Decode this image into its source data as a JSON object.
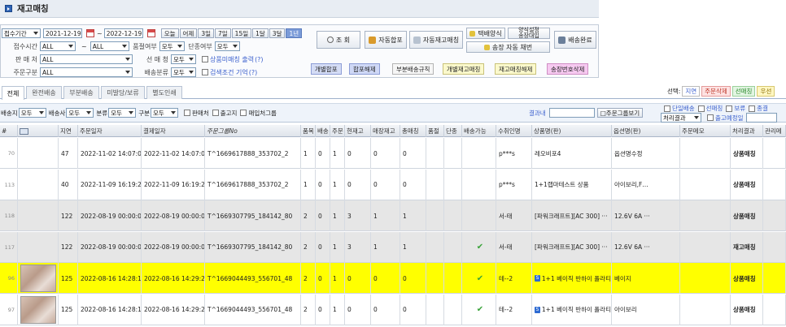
{
  "title": "재고매칭",
  "filters": {
    "date_type": "접수기간",
    "date_from": "2021-12-19",
    "tilde": "~",
    "date_to": "2022-12-19",
    "quick_ranges": [
      "오늘",
      "어제",
      "3일",
      "7일",
      "15일",
      "1달",
      "3달",
      "1년"
    ],
    "active_range": "1년",
    "recv_time_label": "접수시간",
    "recv_time_from": "ALL",
    "recv_time_to": "ALL",
    "soldout_label": "품절여부",
    "soldout_value": "모두",
    "discont_label": "단종여부",
    "discont_value": "모두",
    "seller_label": "판 매 처",
    "seller_value": "ALL",
    "supplier_label": "선 매 청",
    "supplier_value": "모두",
    "unmatched_label": "상품미매칭 출력",
    "order_type_label": "주문구분",
    "order_type_value": "ALL",
    "ship_type_label": "배송분류",
    "ship_type_value": "모두",
    "remember_label": "검색조건 기억",
    "help_mark": "(?)"
  },
  "buttons": {
    "search": "조 회",
    "auto_merge": "자동합포",
    "auto_stock_match": "자동재고매칭",
    "courier_format": "택배양식",
    "format_setting_1": "양식설정",
    "format_setting_2": "송장대입",
    "invoice_auto": "송장 자동 채번",
    "ship_complete": "배송완료",
    "indiv_merge": "개별합포",
    "merge_release": "합포해제",
    "partial_rule": "부분배송규칙",
    "indiv_stock_match": "개별재고매칭",
    "stock_match_release": "재고매칭해제",
    "invoice_delete": "송장번호삭제"
  },
  "tabs": [
    "전체",
    "완전배송",
    "부분배송",
    "미발당/보류",
    "별도인쇄"
  ],
  "active_tab": "전체",
  "selection": {
    "label": "선택:",
    "delay": "지연",
    "order_delete": "주문삭제",
    "sel_match": "선매칭",
    "priority": "우선"
  },
  "toolbar": {
    "ship_to_label": "배송지",
    "ship_to_value": "모두",
    "courier_label": "배송사",
    "courier_value": "모두",
    "cat_label": "분류",
    "cat_value": "모두",
    "kind_label": "구분",
    "kind_value": "모두",
    "seller_chk": "판매처",
    "stop_chk": "출고지",
    "match_group_chk": "매입처그룹",
    "result_search_label": "결과내",
    "order_group_view": "□주문그룹보기",
    "single_ship": "단일배송",
    "sel_match": "선매칭",
    "hold": "보류",
    "combine": "종결",
    "process_result": "처리결과",
    "ship_schedule": "출고예정일"
  },
  "columns": [
    "#",
    "",
    "지연",
    "주문일자",
    "결제일자",
    "주문그룹No",
    "품목",
    "배송",
    "주문",
    "현재고",
    "매장재고",
    "총매칭",
    "품절",
    "단종",
    "배송가능",
    "수취인명",
    "상품명(판)",
    "옵션명(판)",
    "주문메모",
    "처리결과",
    "관리메"
  ],
  "rows": [
    {
      "no": "70",
      "thumb": false,
      "delay": "47",
      "order_date": "2022-11-02 14:07:03",
      "pay_date": "2022-11-02 14:07:03",
      "group_no": "T^1669617888_353702_2",
      "items": "1",
      "ship": "0",
      "order": "1",
      "stock": "0",
      "store_stock": "0",
      "total_match": "0",
      "soldout": "",
      "discont": "",
      "shippable": false,
      "recipient": "p***s",
      "product": "레오비포4",
      "product_badge": false,
      "option": "옵션명수정",
      "memo": "",
      "result": "상품매칭",
      "style": "white"
    },
    {
      "no": "113",
      "thumb": false,
      "delay": "40",
      "order_date": "2022-11-09 16:19:24",
      "pay_date": "2022-11-09 16:19:24",
      "group_no": "T^1669617888_353702_2",
      "items": "1",
      "ship": "0",
      "order": "1",
      "stock": "0",
      "store_stock": "0",
      "total_match": "0",
      "soldout": "",
      "discont": "",
      "shippable": false,
      "recipient": "p***s",
      "product": "1+1랩마테스트 상품",
      "product_badge": false,
      "option": "아이보리,F…",
      "memo": "",
      "result": "상품매칭",
      "style": "white"
    },
    {
      "no": "118",
      "thumb": false,
      "delay": "122",
      "order_date": "2022-08-19 00:00:00",
      "pay_date": "2022-08-19 00:00:00",
      "group_no": "T^1669307795_184142_80",
      "items": "2",
      "ship": "0",
      "order": "1",
      "stock": "3",
      "store_stock": "1",
      "total_match": "1",
      "soldout": "",
      "discont": "",
      "shippable": false,
      "recipient": "서-태",
      "product": "[파워크래프트][AC 300] ···",
      "product_badge": false,
      "option": "12.6V 6A ···",
      "memo": "",
      "result": "상품매칭",
      "style": "gray"
    },
    {
      "no": "117",
      "thumb": false,
      "delay": "122",
      "order_date": "2022-08-19 00:00:00",
      "pay_date": "2022-08-19 00:00:00",
      "group_no": "T^1669307795_184142_80",
      "items": "2",
      "ship": "0",
      "order": "1",
      "stock": "3",
      "store_stock": "1",
      "total_match": "1",
      "soldout": "",
      "discont": "",
      "shippable": true,
      "recipient": "서-태",
      "product": "[파워크래프트][AC 300] ···",
      "product_badge": false,
      "option": "12.6V 6A ···",
      "memo": "",
      "result": "재고매칭",
      "style": "gray"
    },
    {
      "no": "96",
      "thumb": true,
      "delay": "125",
      "order_date": "2022-08-16 14:28:16",
      "pay_date": "2022-08-16 14:29:25",
      "group_no": "T^1669044493_556701_48",
      "items": "2",
      "ship": "0",
      "order": "1",
      "stock": "0",
      "store_stock": "0",
      "total_match": "0",
      "soldout": "",
      "discont": "",
      "shippable": true,
      "recipient": "테--2",
      "product": "1+1 베이직 반하이 폴라티",
      "product_badge": true,
      "option": "베이지",
      "memo": "",
      "result": "상품매칭",
      "style": "yellow"
    },
    {
      "no": "97",
      "thumb": true,
      "delay": "125",
      "order_date": "2022-08-16 14:28:16",
      "pay_date": "2022-08-16 14:29:25",
      "group_no": "T^1669044493_556701_48",
      "items": "2",
      "ship": "0",
      "order": "1",
      "stock": "0",
      "store_stock": "0",
      "total_match": "0",
      "soldout": "",
      "discont": "",
      "shippable": true,
      "recipient": "테--2",
      "product": "1+1 베이직 반하이 폴라티",
      "product_badge": true,
      "option": "아이보리",
      "memo": "",
      "result": "상품매칭",
      "style": "white"
    }
  ],
  "colors": {
    "accent": "#2f64b5",
    "active_range": "#7b9bd8",
    "yellow_row": "#ffff00",
    "gray_row": "#e6e6e6"
  }
}
